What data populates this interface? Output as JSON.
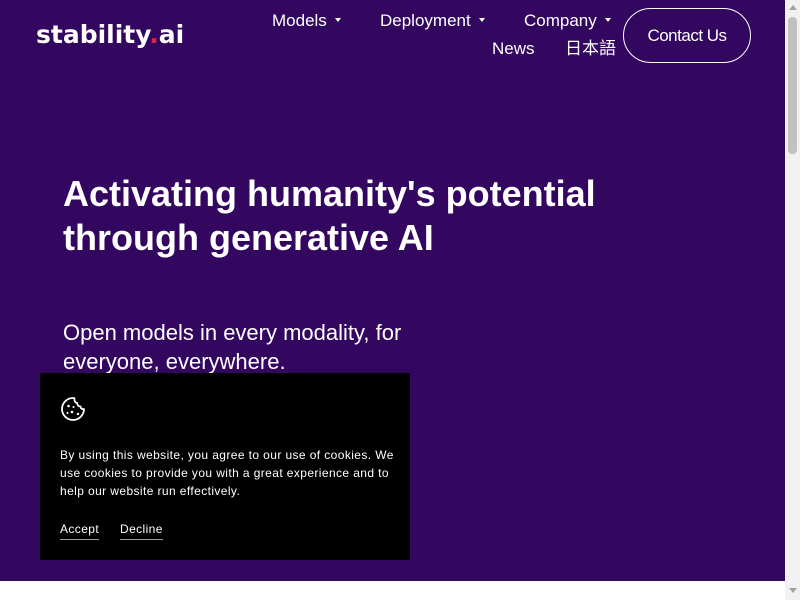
{
  "brand": {
    "logo_main": "stability",
    "logo_dot": ".",
    "logo_suffix": "ai"
  },
  "nav": {
    "items": [
      {
        "label": "Models",
        "has_dropdown": true
      },
      {
        "label": "Deployment",
        "has_dropdown": true
      },
      {
        "label": "Company",
        "has_dropdown": true
      },
      {
        "label": "News",
        "has_dropdown": false
      },
      {
        "label": "日本語",
        "has_dropdown": false
      }
    ],
    "contact_label": "Contact Us"
  },
  "hero": {
    "headline": "Activating humanity's potential through generative AI",
    "subheadline": "Open models in every modality, for everyone, everywhere."
  },
  "cookie_banner": {
    "icon": "cookie-icon",
    "text": "By using this website, you agree to our use of cookies. We use cookies to provide you with a great experience and to help our website run effectively.",
    "accept_label": "Accept",
    "decline_label": "Decline"
  },
  "colors": {
    "hero_background": "#330660",
    "logo_accent": "#e0233c",
    "banner_background": "#000000"
  }
}
